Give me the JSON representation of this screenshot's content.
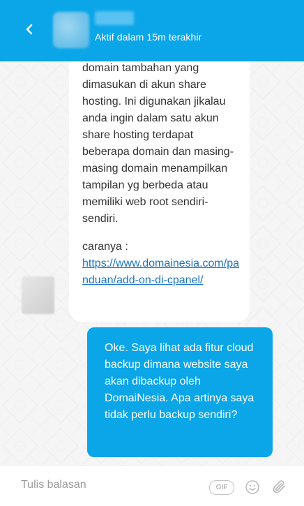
{
  "header": {
    "status": "Aktif dalam 15m terakhir"
  },
  "messages": {
    "incoming": {
      "paragraph1": "domain tambahan yang dimasukan di akun share hosting. Ini digunakan jikalau anda ingin dalam satu akun share hosting terdapat beberapa domain dan masing-masing domain menampilkan tampilan yg berbeda atau memiliki web root sendiri-sendiri.",
      "paragraph2_label": "caranya :",
      "link": "https://www.domainesia.com/panduan/add-on-di-cpanel/"
    },
    "outgoing": {
      "text": "Oke. Saya lihat ada fitur cloud backup dimana website saya akan dibackup oleh DomaiNesia. Apa artinya saya tidak perlu backup sendiri?"
    }
  },
  "composer": {
    "placeholder": "Tulis balasan",
    "gif_label": "GIF"
  },
  "icons": {
    "back": "chevron-left-icon",
    "emoji": "emoji-icon",
    "attach": "paperclip-icon"
  },
  "colors": {
    "accent": "#0aa6e8",
    "link": "#1a73c8"
  }
}
